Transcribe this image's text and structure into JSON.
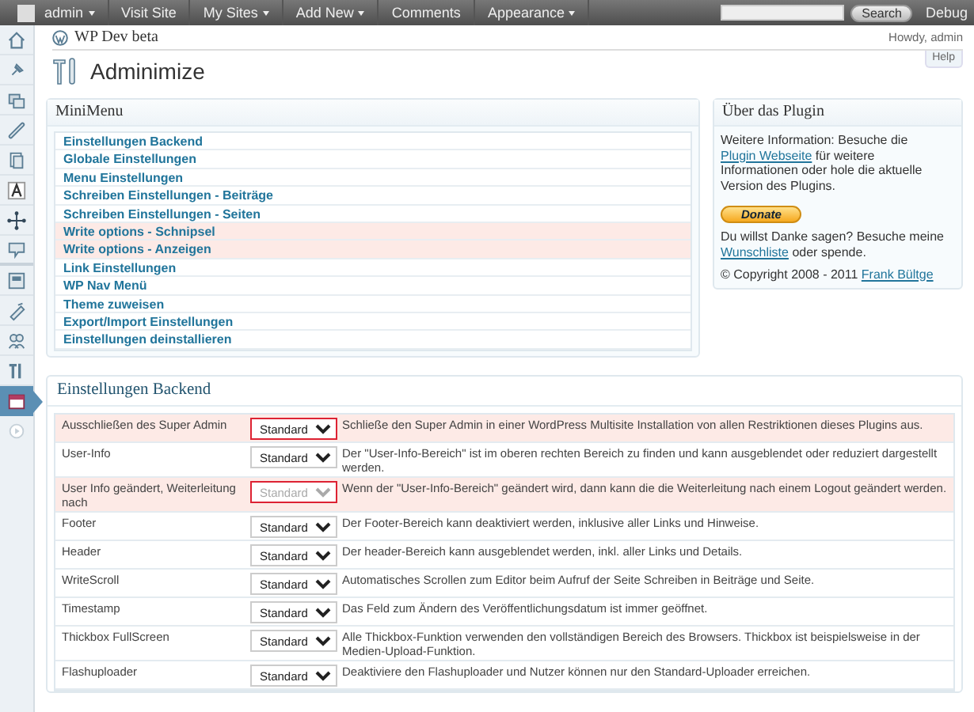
{
  "admin_bar": {
    "user": {
      "label": "admin",
      "dropdown": true
    },
    "menu": [
      {
        "label": "Visit Site",
        "dropdown": false
      },
      {
        "label": "My Sites",
        "dropdown": true
      },
      {
        "label": "Add New",
        "dropdown": true
      },
      {
        "label": "Comments",
        "dropdown": false
      },
      {
        "label": "Appearance",
        "dropdown": true
      }
    ],
    "search_button": "Search",
    "debug": "Debug"
  },
  "sidebar": {
    "items": [
      {
        "selected": false
      },
      {
        "selected": false
      },
      {
        "selected": false
      },
      {
        "selected": false
      },
      {
        "selected": false
      },
      {
        "selected": false
      },
      {
        "selected": false
      },
      {
        "selected": false
      },
      {
        "selected": false
      },
      {
        "selected": false
      },
      {
        "selected": false
      },
      {
        "selected": false
      },
      {
        "selected": true
      },
      {
        "selected": false
      }
    ]
  },
  "header": {
    "site": "WP Dev beta",
    "howdy": "Howdy, admin"
  },
  "title": "Adminimize",
  "help": "Help",
  "minimenu": {
    "title": "MiniMenu",
    "items": [
      {
        "label": "Einstellungen Backend",
        "highlighted": false
      },
      {
        "label": "Globale Einstellungen",
        "highlighted": false
      },
      {
        "label": "Menu Einstellungen",
        "highlighted": false
      },
      {
        "label": "Schreiben Einstellungen - Beiträge",
        "highlighted": false
      },
      {
        "label": "Schreiben Einstellungen - Seiten",
        "highlighted": false
      },
      {
        "label": "Write options - Schnipsel",
        "highlighted": true
      },
      {
        "label": "Write options - Anzeigen",
        "highlighted": true
      },
      {
        "label": "Link Einstellungen",
        "highlighted": false
      },
      {
        "label": "WP Nav Menü",
        "highlighted": false
      },
      {
        "label": "Theme zuweisen",
        "highlighted": false
      },
      {
        "label": "Export/Import Einstellungen",
        "highlighted": false
      },
      {
        "label": "Einstellungen deinstallieren",
        "highlighted": false
      }
    ]
  },
  "plugin_box": {
    "title": "Über das Plugin",
    "info": {
      "before": "Weitere Information: Besuche die ",
      "link": "Plugin Webseite",
      "after": " für weitere Informationen oder hole die aktuelle Version des Plugins."
    },
    "donate": "Donate",
    "thanks": {
      "before": "Du willst Danke sagen? Besuche meine ",
      "link": "Wunschliste",
      "after": " oder spende."
    },
    "copyright": {
      "before": "© Copyright 2008 - 2011 ",
      "link": "Frank Bültge"
    }
  },
  "settings": {
    "title": "Einstellungen Backend",
    "rows": [
      {
        "label": "Ausschließen des Super Admin",
        "value": "Standard",
        "highlighted": true,
        "disabled": false,
        "description": "Schließe den Super Admin in einer WordPress Multisite Installation von allen Restriktionen dieses Plugins aus."
      },
      {
        "label": "User-Info",
        "value": "Standard",
        "highlighted": false,
        "disabled": false,
        "description": "Der \"User-Info-Bereich\" ist im oberen rechten Bereich zu finden und kann ausgeblendet oder reduziert dargestellt werden."
      },
      {
        "label": "User Info geändert, Weiterleitung nach",
        "value": "Standard",
        "highlighted": true,
        "disabled": true,
        "description": "Wenn der \"User-Info-Bereich\" geändert wird, dann kann die die Weiterleitung nach einem Logout geändert werden."
      },
      {
        "label": "Footer",
        "value": "Standard",
        "highlighted": false,
        "disabled": false,
        "description": "Der Footer-Bereich kann deaktiviert werden, inklusive aller Links und Hinweise."
      },
      {
        "label": "Header",
        "value": "Standard",
        "highlighted": false,
        "disabled": false,
        "description": "Der header-Bereich kann ausgeblendet werden, inkl. aller Links und Details."
      },
      {
        "label": "WriteScroll",
        "value": "Standard",
        "highlighted": false,
        "disabled": false,
        "description": "Automatisches Scrollen zum Editor beim Aufruf der Seite Schreiben in Beiträge und Seite."
      },
      {
        "label": "Timestamp",
        "value": "Standard",
        "highlighted": false,
        "disabled": false,
        "description": "Das Feld zum Ändern des Veröffentlichungsdatum ist immer geöffnet."
      },
      {
        "label": "Thickbox FullScreen",
        "value": "Standard",
        "highlighted": false,
        "disabled": false,
        "description": "Alle Thickbox-Funktion verwenden den vollständigen Bereich des Browsers. Thickbox ist beispielsweise in der Medien-Upload-Funktion."
      },
      {
        "label": "Flashuploader",
        "value": "Standard",
        "highlighted": false,
        "disabled": false,
        "description": "Deaktiviere den Flashuploader und Nutzer können nur den Standard-Uploader erreichen."
      }
    ]
  }
}
